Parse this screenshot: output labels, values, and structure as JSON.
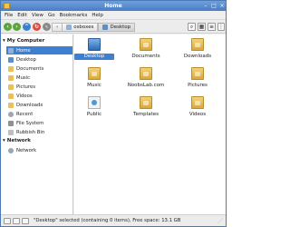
{
  "window": {
    "title": "Home"
  },
  "menu": [
    "File",
    "Edit",
    "View",
    "Go",
    "Bookmarks",
    "Help"
  ],
  "toolbar": {
    "crumbs": [
      {
        "label": "osboxes",
        "icon": "home-icon"
      },
      {
        "label": "Desktop",
        "icon": "desktop-icon"
      }
    ]
  },
  "sidebar": {
    "sections": [
      {
        "title": "My Computer",
        "items": [
          {
            "label": "Home",
            "icon": "home-icon",
            "selected": true
          },
          {
            "label": "Desktop",
            "icon": "desktop-icon"
          },
          {
            "label": "Documents",
            "icon": "folder-icon"
          },
          {
            "label": "Music",
            "icon": "folder-icon"
          },
          {
            "label": "Pictures",
            "icon": "folder-icon"
          },
          {
            "label": "Videos",
            "icon": "folder-icon"
          },
          {
            "label": "Downloads",
            "icon": "folder-icon"
          },
          {
            "label": "Recent",
            "icon": "recent-icon"
          },
          {
            "label": "File System",
            "icon": "disk-icon"
          },
          {
            "label": "Rubbish Bin",
            "icon": "trash-icon"
          }
        ]
      },
      {
        "title": "Network",
        "items": [
          {
            "label": "Network",
            "icon": "network-icon"
          }
        ]
      }
    ]
  },
  "files": [
    {
      "label": "Desktop",
      "icon": "desktop-folder-icon",
      "selected": true
    },
    {
      "label": "Documents",
      "icon": "folder-icon"
    },
    {
      "label": "Downloads",
      "icon": "folder-icon"
    },
    {
      "label": "Music",
      "icon": "folder-icon"
    },
    {
      "label": "NoobsLab.com",
      "icon": "folder-icon"
    },
    {
      "label": "Pictures",
      "icon": "folder-icon"
    },
    {
      "label": "Public",
      "icon": "public-folder-icon"
    },
    {
      "label": "Templates",
      "icon": "folder-icon"
    },
    {
      "label": "Videos",
      "icon": "folder-icon"
    }
  ],
  "status": {
    "text": "\"Desktop\" selected (containing 0 items), Free space: 13.1 GB"
  },
  "colors": {
    "titlebar": "#4a7cc3",
    "selection": "#3d7fd1",
    "folder": "#e8c15b"
  }
}
